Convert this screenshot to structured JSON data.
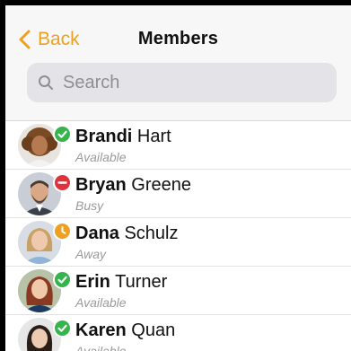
{
  "header": {
    "back_label": "Back",
    "title": "Members",
    "accent_color": "#f0a020"
  },
  "search": {
    "placeholder": "Search",
    "value": ""
  },
  "members": [
    {
      "first": "Brandi",
      "last": "Hart",
      "status": "Available",
      "status_icon": "check-icon",
      "status_color": "#34b44a",
      "avatar": "woman-curly-hair"
    },
    {
      "first": "Bryan",
      "last": "Greene",
      "status": "Busy",
      "status_icon": "minus-icon",
      "status_color": "#e0323a",
      "avatar": "man-beard"
    },
    {
      "first": "Dana",
      "last": "Schulz",
      "status": "Away",
      "status_icon": "clock-icon",
      "status_color": "#f0a020",
      "avatar": "woman-blonde"
    },
    {
      "first": "Erin",
      "last": "Turner",
      "status": "Available",
      "status_icon": "check-icon",
      "status_color": "#34b44a",
      "avatar": "woman-auburn"
    },
    {
      "first": "Karen",
      "last": "Quan",
      "status": "Available",
      "status_icon": "check-icon",
      "status_color": "#34b44a",
      "avatar": "woman-dark-hair"
    }
  ]
}
